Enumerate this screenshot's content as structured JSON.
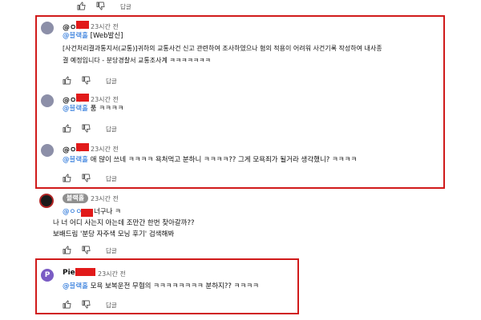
{
  "top_reply": {
    "reply_label": "답글"
  },
  "comments": [
    {
      "handle": "@ㅇㅇ",
      "time": "23시간 전",
      "mention": "@블랙홀",
      "line1_suffix": " [Web발신]",
      "line2": "[사건처리결과통지서(교통)]귀하의 교통사건 신고 관련하여 조사하였으나 혐의 적용이 어려워 사건기록 작성하여 내사종",
      "line3": "결 예정입니다 - 분당경찰서 교통조사계  ㅋㅋㅋㅋㅋㅋㅋ",
      "reply_label": "답글"
    },
    {
      "handle": "@ㅇㅇ",
      "time": "23시간 전",
      "mention": "@블랙홀",
      "line1_suffix": " 품 ㅋㅋㅋㅋ",
      "reply_label": "답글"
    },
    {
      "handle": "@ㅇㅇ",
      "time": "23시간 전",
      "mention": "@블랙홀",
      "line1_suffix": " 애 많이 쓰네 ㅋㅋㅋㅋ 욕처먹고 분하니 ㅋㅋㅋㅋ?? 그게 모욕죄가 될거라 생각했니? ㅋㅋㅋㅋ",
      "reply_label": "답글"
    },
    {
      "handle_badge": "블랙홀",
      "time": "23시간 전",
      "mention": "@ㅇㅇ",
      "line1_suffix": " 너구나 ㅋ",
      "line2": "나 너 어디 사는지 아는데 조만간 한번 찾아갈까??",
      "line3": "보배드림 '분당 자주색 모닝 후기' 검색해봐",
      "reply_label": "답글"
    },
    {
      "avatar_letter": "P",
      "handle": "Pie",
      "time": "23시간 전",
      "mention": "@블랙홀",
      "line1_suffix": " 모욕 보복운전 무혐의 ㅋㅋㅋㅋㅋㅋㅋㅋ 분하지?? ㅋㅋㅋㅋ",
      "reply_label": "답글"
    }
  ],
  "colors": {
    "frame": "#d01a1a",
    "mention": "#065fd4",
    "redaction": "#e11a1a"
  }
}
